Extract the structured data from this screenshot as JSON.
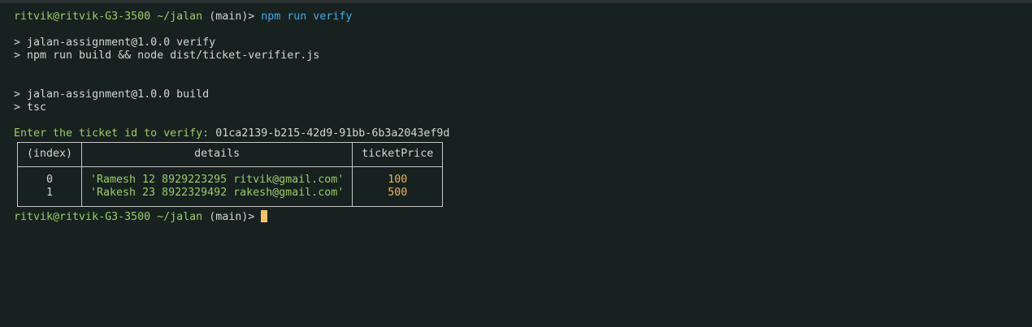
{
  "prompt": {
    "user_host": "ritvik@ritvik-G3-3500",
    "path": "~/jalan",
    "branch": "(main)>"
  },
  "command": "npm run verify",
  "output": {
    "verify_header": "> jalan-assignment@1.0.0 verify",
    "verify_cmd": "> npm run build && node dist/ticket-verifier.js",
    "build_header": "> jalan-assignment@1.0.0 build",
    "build_cmd": "> tsc",
    "ticket_prompt": "Enter the ticket id to verify:",
    "ticket_id": "01ca2139-b215-42d9-91bb-6b3a2043ef9d"
  },
  "table": {
    "columns": [
      "(index)",
      "details",
      "ticketPrice"
    ],
    "rows": [
      {
        "index": "0",
        "details": "'Ramesh 12 8929223295 ritvik@gmail.com'",
        "ticketPrice": "100"
      },
      {
        "index": "1",
        "details": "'Rakesh 23 8922329492 rakesh@gmail.com'",
        "ticketPrice": "500"
      }
    ]
  },
  "colors": {
    "background": "#172120",
    "prompt_green": "#9ccc65",
    "command_blue": "#3daee9",
    "number_orange": "#f0b35a",
    "cursor": "#f8c26c"
  }
}
